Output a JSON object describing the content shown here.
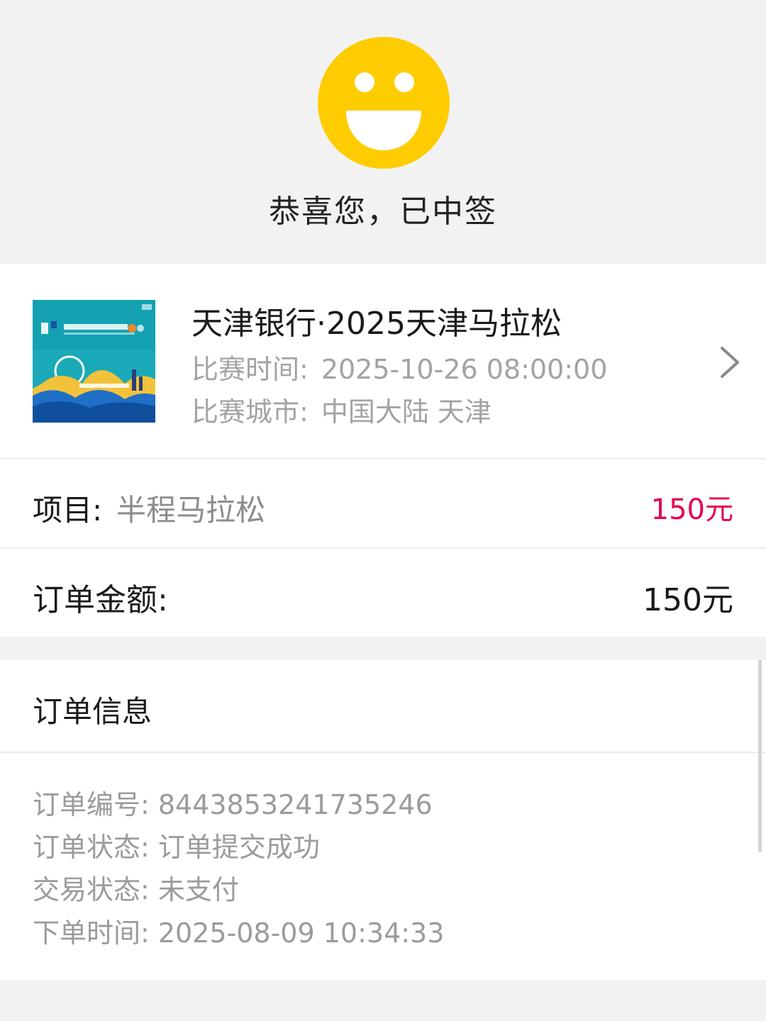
{
  "hero": {
    "icon": "smiley-face-icon",
    "title": "恭喜您，已中签",
    "colors": {
      "smiley": "#FFCC00"
    }
  },
  "event": {
    "poster_icon": "tianjin-marathon-poster",
    "title": "天津银行·2025天津马拉松",
    "time_label": "比赛时间:",
    "time_value": "2025-10-26 08:00:00",
    "city_label": "比赛城市:",
    "city_value": "中国大陆 天津",
    "chevron_icon": "chevron-right-icon"
  },
  "item": {
    "label": "项目:",
    "value": "半程马拉松",
    "price": "150元",
    "price_color": "#E5004F"
  },
  "amount": {
    "label": "订单金额:",
    "value": "150元"
  },
  "order_info": {
    "title": "订单信息",
    "lines": [
      {
        "label": "订单编号:",
        "value": "8443853241735246"
      },
      {
        "label": "订单状态:",
        "value": "订单提交成功"
      },
      {
        "label": "交易状态:",
        "value": "未支付"
      },
      {
        "label": "下单时间:",
        "value": "2025-08-09 10:34:33"
      }
    ]
  }
}
